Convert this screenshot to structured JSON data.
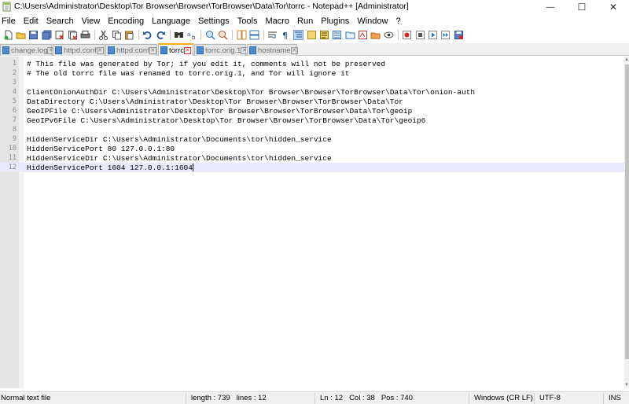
{
  "window": {
    "title": "C:\\Users\\Administrator\\Desktop\\Tor Browser\\Browser\\TorBrowser\\Data\\Tor\\torrc - Notepad++ [Administrator]",
    "minimize_glyph": "—",
    "maximize_glyph": "☐",
    "close_glyph": "✕"
  },
  "menu": [
    "File",
    "Edit",
    "Search",
    "View",
    "Encoding",
    "Language",
    "Settings",
    "Tools",
    "Macro",
    "Run",
    "Plugins",
    "Window",
    "?"
  ],
  "tabs": [
    {
      "label": "change.log",
      "active": false
    },
    {
      "label": "httpd.conf",
      "active": false
    },
    {
      "label": "httpd.conf",
      "active": false
    },
    {
      "label": "torrc",
      "active": true
    },
    {
      "label": "torrc.orig.1",
      "active": false
    },
    {
      "label": "hostname",
      "active": false
    }
  ],
  "editor": {
    "lines": [
      {
        "num": "1",
        "text": "# This file was generated by Tor; if you edit it, comments will not be preserved"
      },
      {
        "num": "2",
        "text": "# The old torrc file was renamed to torrc.orig.1, and Tor will ignore it"
      },
      {
        "num": "3",
        "text": ""
      },
      {
        "num": "4",
        "text": "ClientOnionAuthDir C:\\Users\\Administrator\\Desktop\\Tor Browser\\Browser\\TorBrowser\\Data\\Tor\\onion-auth"
      },
      {
        "num": "5",
        "text": "DataDirectory C:\\Users\\Administrator\\Desktop\\Tor Browser\\Browser\\TorBrowser\\Data\\Tor"
      },
      {
        "num": "6",
        "text": "GeoIPFile C:\\Users\\Administrator\\Desktop\\Tor Browser\\Browser\\TorBrowser\\Data\\Tor\\geoip"
      },
      {
        "num": "7",
        "text": "GeoIPv6File C:\\Users\\Administrator\\Desktop\\Tor Browser\\Browser\\TorBrowser\\Data\\Tor\\geoip6"
      },
      {
        "num": "8",
        "text": ""
      },
      {
        "num": "9",
        "text": "HiddenServiceDir C:\\Users\\Administrator\\Documents\\tor\\hidden_service"
      },
      {
        "num": "10",
        "text": "HiddenServicePort 80 127.0.0.1:80"
      },
      {
        "num": "11",
        "text": "HiddenServiceDir C:\\Users\\Administrator\\Documents\\tor\\hidden_service"
      },
      {
        "num": "12",
        "text": "HiddenServicePort 1604 127.0.0.1:1604"
      }
    ],
    "current_line": 12
  },
  "status": {
    "file_type": "Normal text file",
    "length": "length : 739",
    "lines": "lines : 12",
    "ln": "Ln : 12",
    "col": "Col : 38",
    "pos": "Pos : 740",
    "eol": "Windows (CR LF)",
    "encoding": "UTF-8",
    "mode": "INS"
  },
  "colors": {
    "active_tab_accent": "#ffaa22",
    "current_line_bg": "#e8e8ff",
    "gutter_bg": "#e4e4e4"
  }
}
